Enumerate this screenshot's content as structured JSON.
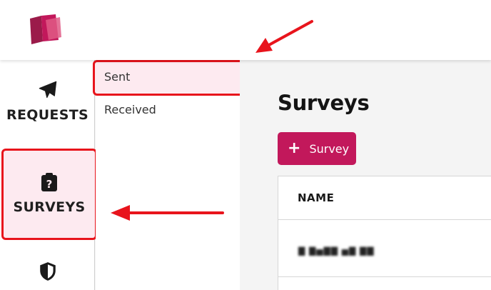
{
  "navigation": {
    "rail": [
      {
        "label": "REQUESTS",
        "icon": "send-icon"
      },
      {
        "label": "SURVEYS",
        "icon": "survey-clipboard-icon",
        "selected": true
      },
      {
        "label": "",
        "icon": "shield-icon"
      }
    ],
    "subnav": [
      {
        "label": "Sent",
        "selected": true
      },
      {
        "label": "Received"
      }
    ]
  },
  "main": {
    "title": "Surveys",
    "add_button_label": "Survey",
    "table": {
      "columns": [
        "NAME"
      ],
      "rows": [
        {
          "name": "▇ ▇▅▇▇ ▅▇ ▇▇"
        }
      ]
    }
  },
  "colors": {
    "accent": "#c2185b",
    "selected_bg": "#fdeaf0",
    "annotation_red": "#e8141c"
  }
}
